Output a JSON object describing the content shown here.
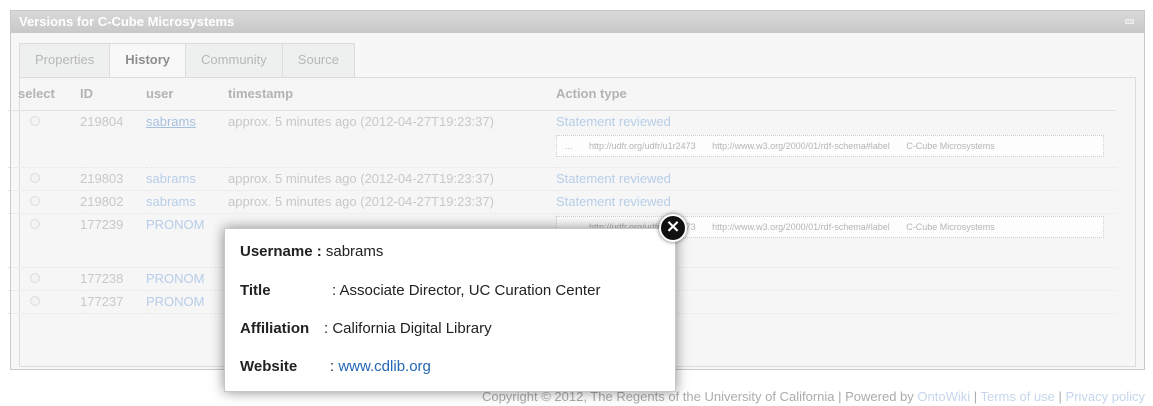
{
  "window": {
    "title": "Versions for C-Cube Microsystems"
  },
  "tabs": [
    {
      "label": "Properties"
    },
    {
      "label": "History"
    },
    {
      "label": "Community"
    },
    {
      "label": "Source"
    }
  ],
  "table": {
    "headers": [
      "select",
      "ID",
      "user",
      "timestamp",
      "Action type"
    ],
    "rows": [
      {
        "id": "219804",
        "user": "sabrams",
        "timestamp": "approx. 5 minutes ago (2012-04-27T19:23:37)",
        "action": "Statement reviewed",
        "detail": [
          "...",
          "http://udfr.org/udfr/u1r2473",
          "http://www.w3.org/2000/01/rdf-schema#label",
          "C-Cube Microsystems"
        ]
      },
      {
        "id": "219803",
        "user": "sabrams",
        "timestamp": "approx. 5 minutes ago (2012-04-27T19:23:37)",
        "action": "Statement reviewed"
      },
      {
        "id": "219802",
        "user": "sabrams",
        "timestamp": "approx. 5 minutes ago (2012-04-27T19:23:37)",
        "action": "Statement reviewed"
      },
      {
        "id": "177239",
        "user": "PRONOM",
        "timestamp": "",
        "action": "",
        "detail": [
          "...",
          "http://udfr.org/udfr/u1r2473",
          "http://www.w3.org/2000/01/rdf-schema#label",
          "C-Cube Microsystems"
        ]
      },
      {
        "id": "177238",
        "user": "PRONOM",
        "timestamp": "",
        "action": ""
      },
      {
        "id": "177237",
        "user": "PRONOM",
        "timestamp": "",
        "action": ""
      }
    ]
  },
  "footer": {
    "copyright": "Copyright © 2012, The Regents of the University of California | Powered by ",
    "ontowiki": "OntoWiki",
    "sep": " | ",
    "terms": "Terms of use",
    "privacy": "Privacy policy"
  },
  "popup": {
    "username_label": "Username :",
    "username_value": "sabrams",
    "title_label": "Title",
    "title_value": ": Associate Director, UC Curation Center",
    "affiliation_label": "Affiliation",
    "affiliation_value": ": California Digital Library",
    "website_label": "Website",
    "website_sep": ":",
    "website_value": "www.cdlib.org",
    "close_glyph": "×"
  }
}
